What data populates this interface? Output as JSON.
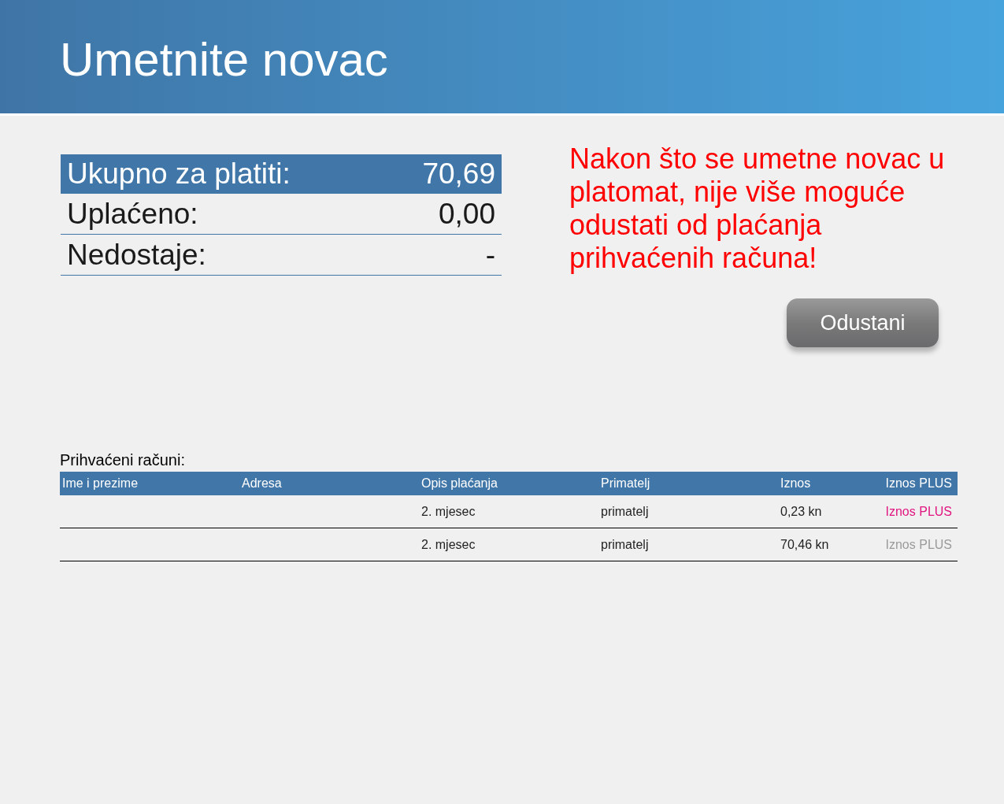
{
  "header": {
    "title": "Umetnite novac"
  },
  "summary": [
    {
      "label": "Ukupno za platiti:",
      "value": "70,69",
      "highlighted": true
    },
    {
      "label": "Uplaćeno:",
      "value": "0,00",
      "highlighted": false
    },
    {
      "label": "Nedostaje:",
      "value": "-",
      "highlighted": false
    }
  ],
  "warning": "Nakon što se umetne novac u platomat, nije više moguće odustati od plaćanja prihvaćenih računa!",
  "cancel_button": "Odustani",
  "bills": {
    "title": "Prihvaćeni računi:",
    "columns": [
      "Ime i prezime",
      "Adresa",
      "Opis plaćanja",
      "Primatelj",
      "Iznos",
      "Iznos PLUS"
    ],
    "rows": [
      {
        "name": "",
        "address": "",
        "description": "2. mjesec",
        "recipient": "primatelj",
        "amount": "0,23 kn",
        "plus": {
          "label": "Iznos PLUS",
          "disabled": false
        }
      },
      {
        "name": "",
        "address": "",
        "description": "2. mjesec",
        "recipient": "primatelj",
        "amount": "70,46 kn",
        "plus": {
          "label": "Iznos PLUS",
          "disabled": true
        }
      }
    ]
  }
}
